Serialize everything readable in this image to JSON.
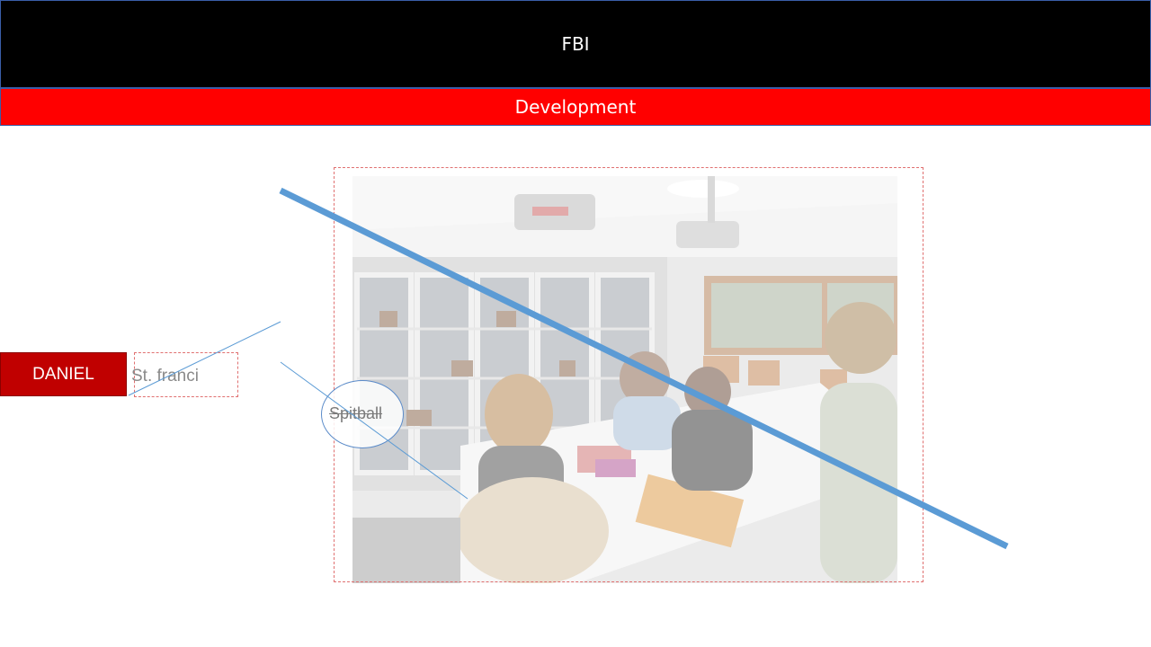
{
  "slide": {
    "title": "FBI",
    "subtitle": "Development"
  },
  "person": {
    "name": "DANIEL",
    "place": "St. franci"
  },
  "bubble": {
    "label": "Spitball"
  },
  "colors": {
    "title_bg": "#000000",
    "subtitle_bg": "#ff0000",
    "name_tag_bg": "#c00000",
    "strike_line": "#5b9bd5",
    "frame_dash": "#e07070"
  },
  "photo": {
    "subject": "classroom-photo"
  }
}
